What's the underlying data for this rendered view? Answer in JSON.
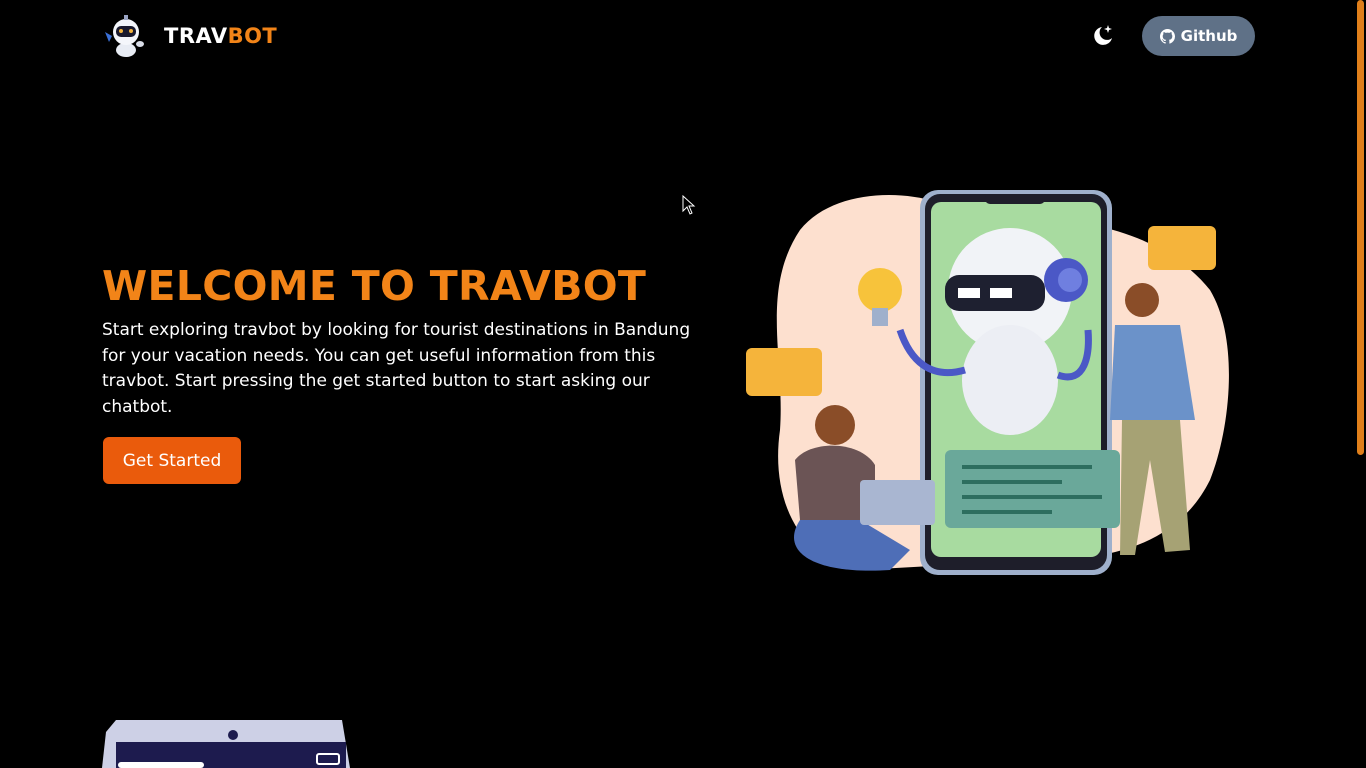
{
  "navbar": {
    "brand_part1": "TRAV",
    "brand_part2": "BOT",
    "github_label": "Github"
  },
  "hero": {
    "title": "WELCOME TO TRAVBOT",
    "description": "Start exploring travbot by looking for tourist destinations in Bandung for your vacation needs. You can get useful information from this travbot. Start pressing the get started button to start asking our chatbot.",
    "cta_label": "Get Started"
  },
  "icons": {
    "logo": "robot-logo-icon",
    "theme": "moon-star-icon",
    "github": "github-icon"
  },
  "colors": {
    "accent": "#f28418",
    "button": "#ea5b0c",
    "github_button": "#5f7187",
    "background": "#000000"
  }
}
